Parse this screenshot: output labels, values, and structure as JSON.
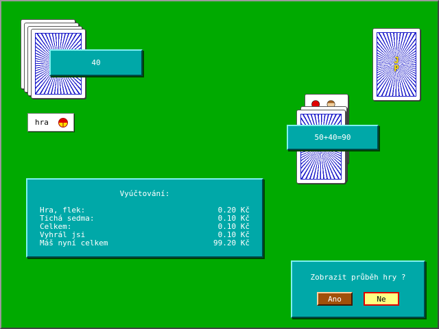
{
  "player_score": "40",
  "bid_label": "hra",
  "opponent_score": "50+40=90",
  "opponent_card_back": {
    "initials": [
      "J",
      "P"
    ]
  },
  "settlement": {
    "title": "Vyúčtování:",
    "rows": [
      {
        "label": "Hra, flek:",
        "value": "0.20 Kč"
      },
      {
        "label": "Tichá sedma:",
        "value": "0.10 Kč"
      },
      {
        "label": "Celkem:",
        "value": "0.10 Kč"
      },
      {
        "label": "Vyhrál jsi",
        "value": "0.10 Kč"
      },
      {
        "label": "Máš nyní celkem",
        "value": "99.20 Kč"
      }
    ]
  },
  "dialog": {
    "question": "Zobrazit průběh hry ?",
    "yes_label": "Ano",
    "no_label": "Ne"
  },
  "colors": {
    "table": "#00aa00",
    "panel": "#00a8a8",
    "card_back": "#1818c8",
    "yes_button": "#a0500a",
    "no_button": "#ffff80"
  }
}
